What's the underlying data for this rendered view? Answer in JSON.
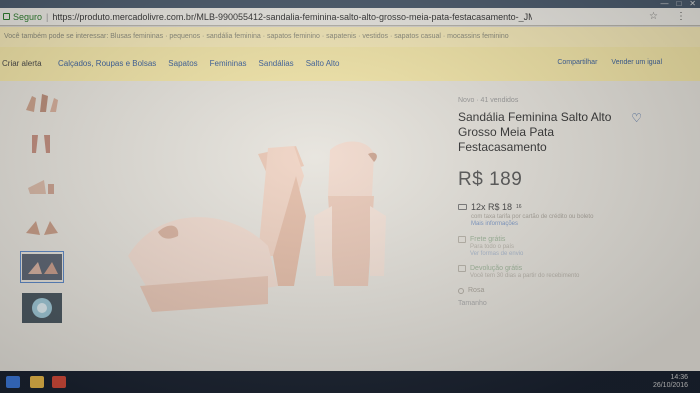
{
  "browser": {
    "secure_label": "Seguro",
    "url": "https://produto.mercadolivre.com.br/MLB-990055412-sandalia-feminina-salto-alto-grosso-meia-pata-festacasamento-_JM"
  },
  "ml": {
    "suggest_bar": "Você também pode se interessar: Blusas femininas · pequenos · sandália feminina · sapatos feminino · sapatenis · vestidos · sapatos casual · mocassins feminino",
    "alert_label": "Criar alerta",
    "categories": [
      "Calçados, Roupas e Bolsas",
      "Sapatos",
      "Femininas",
      "Sandálias",
      "Salto Alto"
    ],
    "right_links": [
      "Compartilhar",
      "Vender um igual"
    ]
  },
  "product": {
    "meta": "Novo · 41 vendidos",
    "title": "Sandália Feminina Salto Alto Grosso Meia Pata Festacasamento",
    "price": "R$ 189",
    "installments": "12x R$ 18",
    "installments_sup": "16",
    "installments_note": "com taxa tarifa por cartão de crédito ou boleto",
    "more_info": "Mais informações",
    "shipping_label": "Frete grátis",
    "shipping_note": "Para todo o país",
    "shipping_link": "Ver formas de envio",
    "returns_label": "Devolução grátis",
    "returns_note": "Você tem 30 dias a partir do recebimento",
    "color_label": "Rosa",
    "size_label": "Tamanho"
  },
  "colors": {
    "accent_blue": "#3a5f9a",
    "ml_yellow": "#f3e6a8",
    "shoe_pink": "#e9c9b6",
    "lace": "#efd9cf"
  },
  "taskbar": {
    "clock_time": "14:36",
    "clock_date": "26/10/2016"
  }
}
